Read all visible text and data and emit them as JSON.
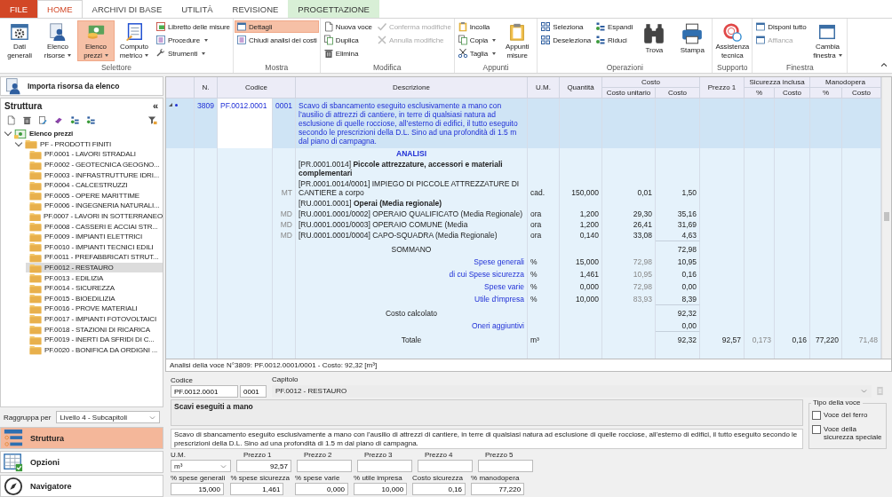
{
  "ribbon": {
    "tabs": [
      {
        "label": "FILE",
        "kind": "file",
        "selected": false
      },
      {
        "label": "HOME",
        "kind": "normal",
        "selected": true
      },
      {
        "label": "ARCHIVI DI BASE",
        "kind": "normal",
        "selected": false
      },
      {
        "label": "UTILITÀ",
        "kind": "normal",
        "selected": false
      },
      {
        "label": "REVISIONE",
        "kind": "normal",
        "selected": false
      },
      {
        "label": "PROGETTAZIONE",
        "kind": "context",
        "selected": false
      }
    ],
    "groups": [
      {
        "label": "Selettore",
        "columns": [
          {
            "kind": "large",
            "items": [
              {
                "label": "Dati generali",
                "selected": false
              }
            ]
          },
          {
            "kind": "large",
            "items": [
              {
                "label": "Elenco risorse",
                "dropdown": true,
                "selected": false
              }
            ]
          },
          {
            "kind": "large",
            "items": [
              {
                "label": "Elenco prezzi",
                "dropdown": true,
                "selected": true
              }
            ]
          },
          {
            "kind": "large",
            "items": [
              {
                "label": "Computo metrico",
                "dropdown": true,
                "selected": false
              }
            ]
          },
          {
            "kind": "stack",
            "items": [
              {
                "label": "Libretto delle misure",
                "selected": false
              },
              {
                "label": "Procedure",
                "dropdown": true,
                "selected": false
              },
              {
                "label": "Strumenti",
                "dropdown": true,
                "selected": false
              }
            ]
          }
        ]
      },
      {
        "label": "Mostra",
        "columns": [
          {
            "kind": "stack",
            "items": [
              {
                "label": "Dettagli",
                "selected": true
              },
              {
                "label": "Chiudi analisi dei costi",
                "selected": false
              }
            ]
          }
        ]
      },
      {
        "label": "Modifica",
        "columns": [
          {
            "kind": "stack",
            "items": [
              {
                "label": "Nuova voce",
                "disabled": false
              },
              {
                "label": "Duplica",
                "disabled": false
              },
              {
                "label": "Elimina",
                "disabled": false
              }
            ]
          },
          {
            "kind": "stack",
            "items": [
              {
                "label": "Conferma modifiche",
                "disabled": true
              },
              {
                "label": "Annulla modifiche",
                "disabled": true
              }
            ]
          }
        ]
      },
      {
        "label": "Appunti",
        "columns": [
          {
            "kind": "stack",
            "items": [
              {
                "label": "Incolla"
              },
              {
                "label": "Copia",
                "dropdown": true
              },
              {
                "label": "Taglia",
                "dropdown": true
              }
            ]
          },
          {
            "kind": "large",
            "items": [
              {
                "label": "Appunti misure"
              }
            ]
          }
        ]
      },
      {
        "label": "Operazioni",
        "columns": [
          {
            "kind": "stack",
            "items": [
              {
                "label": "Seleziona"
              },
              {
                "label": "Deseleziona"
              }
            ]
          },
          {
            "kind": "stack",
            "items": [
              {
                "label": "Espandi"
              },
              {
                "label": "Riduci"
              }
            ]
          },
          {
            "kind": "large",
            "items": [
              {
                "label": "Trova"
              }
            ]
          },
          {
            "kind": "large",
            "items": [
              {
                "label": "Stampa"
              }
            ]
          }
        ]
      },
      {
        "label": "Supporto",
        "columns": [
          {
            "kind": "large",
            "items": [
              {
                "label": "Assistenza tecnica"
              }
            ]
          }
        ]
      },
      {
        "label": "Finestra",
        "columns": [
          {
            "kind": "stack",
            "items": [
              {
                "label": "Disponi tutto",
                "disabled": false
              },
              {
                "label": "Affianca",
                "disabled": true
              }
            ]
          },
          {
            "kind": "large",
            "items": [
              {
                "label": "Cambia finestra",
                "dropdown": true,
                "disabled": false
              }
            ]
          }
        ]
      }
    ]
  },
  "import_button": "Importa risorsa da elenco",
  "structure": {
    "title": "Struttura",
    "collapse": "«",
    "tree": [
      {
        "label": "Elenco prezzi",
        "expanded": true,
        "children": [
          {
            "label": "PF - PRODOTTI FINITI",
            "expanded": true,
            "children": [
              {
                "label": "PF.0001 - LAVORI STRADALI",
                "selected": false
              },
              {
                "label": "PF.0002 - GEOTECNICA GEOGNO...",
                "selected": false
              },
              {
                "label": "PF.0003 - INFRASTRUTTURE IDRI...",
                "selected": false
              },
              {
                "label": "PF.0004 - CALCESTRUZZI",
                "selected": false
              },
              {
                "label": "PF.0005 - OPERE MARITTIME",
                "selected": false
              },
              {
                "label": "PF.0006 - INGEGNERIA NATURALI...",
                "selected": false
              },
              {
                "label": "PF.0007 - LAVORI IN SOTTERRANEO",
                "selected": false
              },
              {
                "label": "PF.0008 - CASSERI E ACCIAI STR...",
                "selected": false
              },
              {
                "label": "PF.0009 - IMPIANTI ELETTRICI",
                "selected": false
              },
              {
                "label": "PF.0010 - IMPIANTI TECNICI EDILI",
                "selected": false
              },
              {
                "label": "PF.0011 - PREFABBRICATI STRUT...",
                "selected": false
              },
              {
                "label": "PF.0012 - RESTAURO",
                "selected": true
              },
              {
                "label": "PF.0013 - EDILIZIA",
                "selected": false
              },
              {
                "label": "PF.0014 - SICUREZZA",
                "selected": false
              },
              {
                "label": "PF.0015 - BIOEDILIZIA",
                "selected": false
              },
              {
                "label": "PF.0016 - PROVE MATERIALI",
                "selected": false
              },
              {
                "label": "PF.0017 - IMPIANTI FOTOVOLTAICI",
                "selected": false
              },
              {
                "label": "PF.0018 - STAZIONI DI RICARICA",
                "selected": false
              },
              {
                "label": "PF.0019 - INERTI DA SFRIDI DI C...",
                "selected": false
              },
              {
                "label": "PF.0020 - BONIFICA DA ORDIGNI ...",
                "selected": false
              }
            ]
          }
        ]
      }
    ]
  },
  "group_by": {
    "label": "Raggruppa per",
    "value": "Livello 4 - Subcapitoli"
  },
  "navigation": [
    {
      "label": "Struttura",
      "selected": true
    },
    {
      "label": "Opzioni",
      "selected": false
    },
    {
      "label": "Navigatore",
      "selected": false
    }
  ],
  "table": {
    "columns": [
      {
        "label": "N."
      },
      {
        "label": "Codice"
      },
      {
        "label": "Descrizione"
      },
      {
        "label": "U.M."
      },
      {
        "label": "Quantità"
      },
      {
        "label": "Costo",
        "sub": [
          "Costo unitario",
          "Costo"
        ]
      },
      {
        "label": "Prezzo 1"
      },
      {
        "label": "Sicurezza inclusa",
        "sub": [
          "%",
          "Costo"
        ]
      },
      {
        "label": "Manodopera",
        "sub": [
          "%",
          "Costo"
        ]
      }
    ],
    "row": {
      "n": "3809",
      "code": "PF.0012.0001",
      "sub": "0001",
      "selected": true,
      "expanded": true,
      "description": "Scavo di sbancamento eseguito esclusivamente a mano con l’ausilio di attrezzi di cantiere, in terre di qualsiasi natura ad esclusione di quelle rocciose, all’esterno di edifici, il tutto eseguito secondo le prescrizioni della D.L. Sino ad una profondità di 1.5 m dal piano di campagna.",
      "analysis": [
        {
          "kind": "heading",
          "label": "ANALISI"
        },
        {
          "kind": "group",
          "text": "[PR.0001.0014] **Piccole attrezzature, accessori e materiali complementari**"
        },
        {
          "kind": "item",
          "tag": "MT",
          "text": "[PR.0001.0014/0001] IMPIEGO DI PICCOLE ATTREZZATURE DI CANTIERE a corpo",
          "um": "cad.",
          "qty": "150,000",
          "unit": "0,01",
          "cost": "1,50"
        },
        {
          "kind": "group",
          "text": "[RU.0001.0001] **Operai (Media regionale)**"
        },
        {
          "kind": "item",
          "tag": "MD",
          "text": "[RU.0001.0001/0002] OPERAIO QUALIFICATO (Media Regionale)",
          "um": "ora",
          "qty": "1,200",
          "unit": "29,30",
          "cost": "35,16"
        },
        {
          "kind": "item",
          "tag": "MD",
          "text": "[RU.0001.0001/0003] OPERAIO COMUNE (Media",
          "um": "ora",
          "qty": "1,200",
          "unit": "26,41",
          "cost": "31,69"
        },
        {
          "kind": "item",
          "tag": "MD",
          "text": "[RU.0001.0001/0004] CAPO-SQUADRA (Media Regionale)",
          "um": "ora",
          "qty": "0,140",
          "unit": "33,08",
          "cost": "4,63"
        },
        {
          "kind": "sum",
          "label": "SOMMANO",
          "cost": "72,98"
        },
        {
          "kind": "charge",
          "label": "Spese generali",
          "um": "%",
          "qty": "15,000",
          "unit": "72,98",
          "cost": "10,95"
        },
        {
          "kind": "charge",
          "label": "di cui Spese sicurezza",
          "um": "%",
          "qty": "1,461",
          "unit": "10,95",
          "cost": "0,16"
        },
        {
          "kind": "charge",
          "label": "Spese varie",
          "um": "%",
          "qty": "0,000",
          "unit": "72,98",
          "cost": "0,00"
        },
        {
          "kind": "charge",
          "label": "Utile d'impresa",
          "um": "%",
          "qty": "10,000",
          "unit": "83,93",
          "cost": "8,39"
        },
        {
          "kind": "sum",
          "label": "Costo calcolato",
          "cost": "92,32"
        },
        {
          "kind": "charge",
          "label": "Oneri aggiuntivi",
          "cost": "0,00"
        },
        {
          "kind": "total",
          "label": "Totale",
          "um": "m³",
          "cost": "92,32",
          "price": "92,57",
          "safety_pct": "0,173",
          "safety_cost": "0,16",
          "labor_pct": "77,220",
          "labor_cost": "71,48"
        }
      ]
    }
  },
  "status": "Analisi della voce N°3809: PF.0012.0001/0001 - Costo: 92,32 [m³]",
  "form": {
    "code": {
      "label": "Codice",
      "value": "PF.0012.0001",
      "sub": "0001"
    },
    "chapter": {
      "label": "Capitolo",
      "value": "PF.0012 - RESTAURO"
    },
    "title": "Scavi eseguiti a mano",
    "description": "Scavo di sbancamento eseguito esclusivamente a mano con l’ausilio di attrezzi di cantiere, in terre di qualsiasi natura ad esclusione di quelle rocciose, all’esterno di edifici, il tutto eseguito secondo le prescrizioni della D.L. Sino ad una profondità di 1.5 m dal piano di campagna.",
    "type": {
      "label": "Tipo della voce",
      "options": [
        {
          "label": "Voce del ferro",
          "checked": false
        },
        {
          "label": "Voce della sicurezza speciale",
          "checked": false
        }
      ]
    },
    "um": {
      "label": "U.M.",
      "value": "m³"
    },
    "prices": [
      {
        "label": "Prezzo 1",
        "value": "92,57"
      },
      {
        "label": "Prezzo 2"
      },
      {
        "label": "Prezzo 3"
      },
      {
        "label": "Prezzo 4"
      },
      {
        "label": "Prezzo 5"
      }
    ],
    "rates": [
      {
        "label": "% spese generali",
        "value": "15,000"
      },
      {
        "label": "% spese sicurezza",
        "value": "1,461"
      },
      {
        "label": "% spese varie",
        "value": "0,000"
      },
      {
        "label": "% utile impresa",
        "value": "10,000"
      },
      {
        "label": "Costo sicurezza",
        "value": "0,16"
      },
      {
        "label": "% manodopera",
        "value": "77,220"
      }
    ]
  }
}
